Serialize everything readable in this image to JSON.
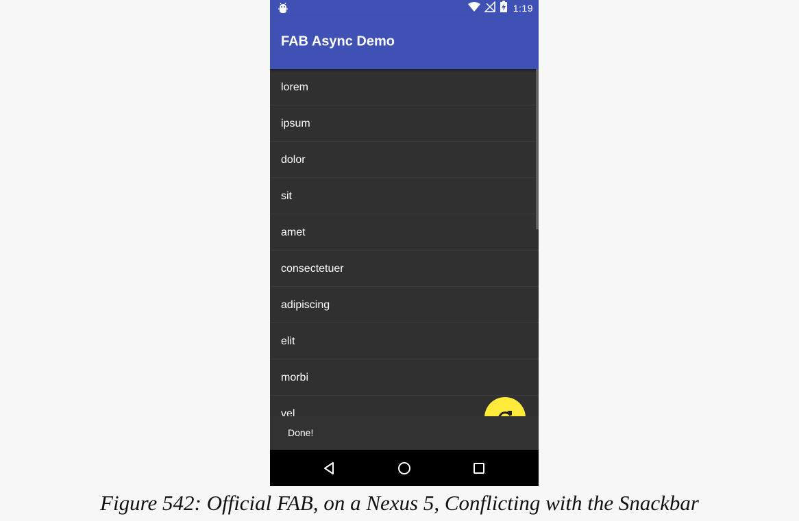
{
  "statusbar": {
    "time": "1:19",
    "icons": [
      "android-debug-icon",
      "wifi-icon",
      "no-signal-icon",
      "battery-charging-icon"
    ]
  },
  "toolbar": {
    "title": "FAB Async Demo"
  },
  "list": {
    "items": [
      "lorem",
      "ipsum",
      "dolor",
      "sit",
      "amet",
      "consectetuer",
      "adipiscing",
      "elit",
      "morbi",
      "vel"
    ],
    "scroll_position_fraction": 0
  },
  "fab": {
    "icon": "refresh-icon",
    "color": "#ffeb3b"
  },
  "snackbar": {
    "message": "Done!"
  },
  "navbar": {
    "buttons": [
      "back-icon",
      "home-icon",
      "recents-icon"
    ]
  },
  "colors": {
    "primary": "#3f51b5",
    "list_background": "#303030",
    "snackbar_background": "#323232",
    "fab": "#ffeb3b",
    "page_background": "#f7f7f7"
  },
  "caption": {
    "text": "Figure 542: Official FAB, on a Nexus 5, Conflicting with the Snackbar"
  }
}
